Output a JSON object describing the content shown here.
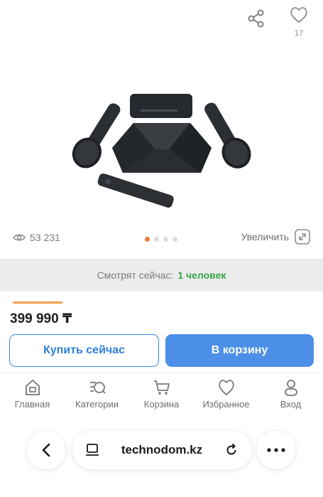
{
  "header": {
    "favorites_count": "17"
  },
  "stats": {
    "views": "53 231",
    "zoom_label": "Увеличить"
  },
  "carousel": {
    "slides": 4,
    "active_index": 0
  },
  "watching": {
    "label": "Смотрят сейчас:",
    "count": "1 человек"
  },
  "product": {
    "price": "399 990 ₸"
  },
  "actions": {
    "buy_now": "Купить сейчас",
    "add_to_cart": "В корзину"
  },
  "tabbar": {
    "items": [
      {
        "label": "Главная",
        "icon": "home-icon"
      },
      {
        "label": "Категории",
        "icon": "categories-search-icon"
      },
      {
        "label": "Корзина",
        "icon": "cart-icon"
      },
      {
        "label": "Избранное",
        "icon": "heart-icon"
      },
      {
        "label": "Вход",
        "icon": "user-icon"
      }
    ]
  },
  "browser": {
    "url": "technodom.kz"
  },
  "colors": {
    "accent": "#4b8fe8",
    "highlight": "#3aa54a",
    "active_dot": "#f07a3b"
  }
}
